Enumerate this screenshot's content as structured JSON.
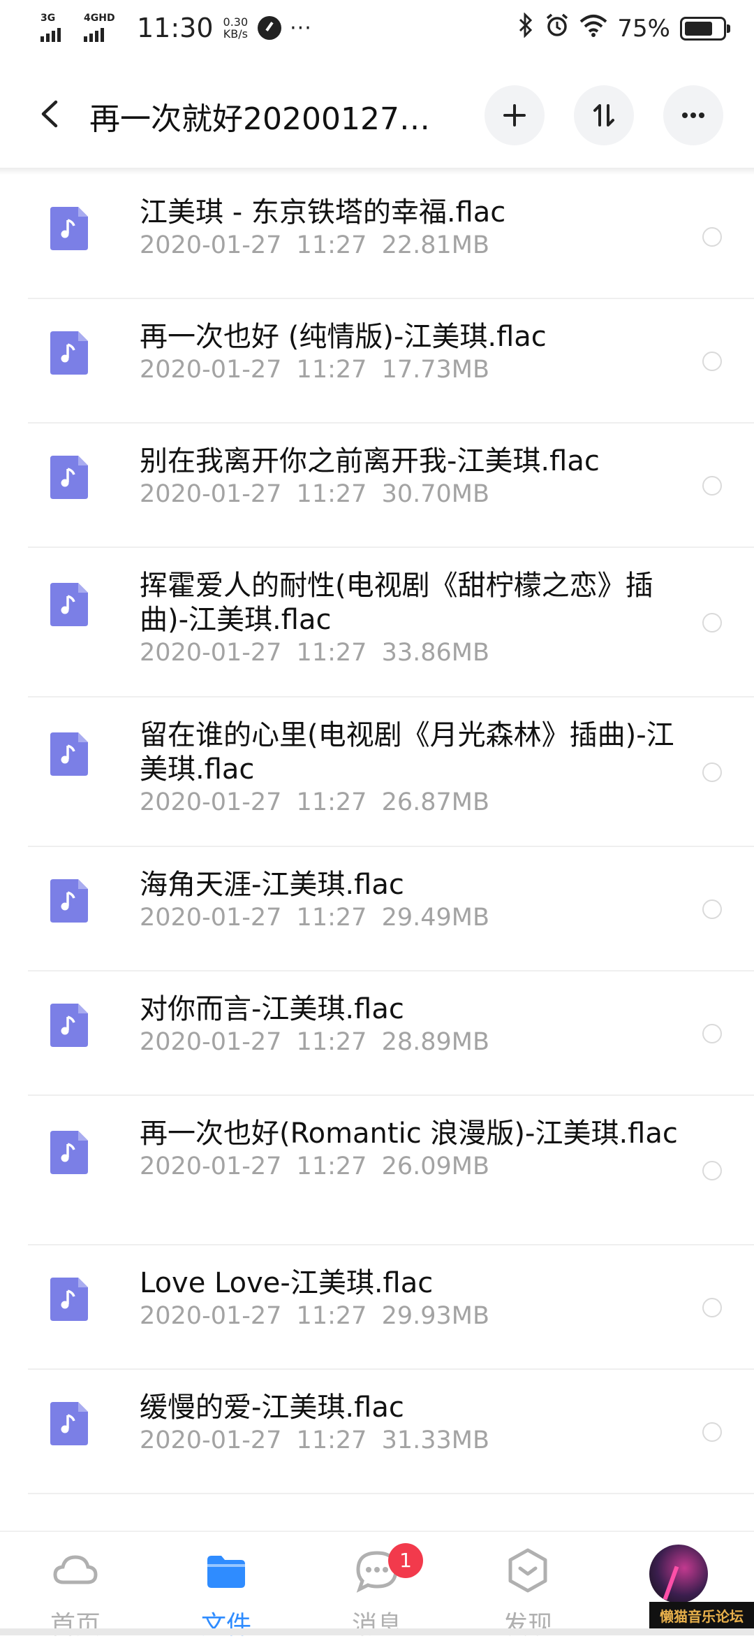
{
  "status_bar": {
    "network1": "3G",
    "network2": "4GHD",
    "time": "11:30",
    "speed_value": "0.30",
    "speed_unit": "KB/s",
    "more": "···",
    "battery_text": "75%",
    "battery_level": 0.75,
    "icons": [
      "bluetooth-icon",
      "alarm-icon",
      "wifi-icon",
      "battery-icon"
    ]
  },
  "header": {
    "title": "再一次就好20200127…",
    "actions": [
      "back-icon",
      "add-icon",
      "sort-icon",
      "more-icon"
    ]
  },
  "files": [
    {
      "name": "江美琪 - 东京铁塔的幸福.flac",
      "date": "2020-01-27",
      "time": "11:27",
      "size": "22.81MB"
    },
    {
      "name": "再一次也好 (纯情版)-江美琪.flac",
      "date": "2020-01-27",
      "time": "11:27",
      "size": "17.73MB"
    },
    {
      "name": "别在我离开你之前离开我-江美琪.flac",
      "date": "2020-01-27",
      "time": "11:27",
      "size": "30.70MB"
    },
    {
      "name": "挥霍爱人的耐性(电视剧《甜柠檬之恋》插曲)-江美琪.flac",
      "date": "2020-01-27",
      "time": "11:27",
      "size": "33.86MB"
    },
    {
      "name": "留在谁的心里(电视剧《月光森林》插曲)-江美琪.flac",
      "date": "2020-01-27",
      "time": "11:27",
      "size": "26.87MB"
    },
    {
      "name": "海角天涯-江美琪.flac",
      "date": "2020-01-27",
      "time": "11:27",
      "size": "29.49MB"
    },
    {
      "name": "对你而言-江美琪.flac",
      "date": "2020-01-27",
      "time": "11:27",
      "size": "28.89MB"
    },
    {
      "name": "再一次也好(Romantic 浪漫版)-江美琪.flac",
      "date": "2020-01-27",
      "time": "11:27",
      "size": "26.09MB"
    },
    {
      "name": "Love Love-江美琪.flac",
      "date": "2020-01-27",
      "time": "11:27",
      "size": "29.93MB"
    },
    {
      "name": "缓慢的爱-江美琪.flac",
      "date": "2020-01-27",
      "time": "11:27",
      "size": "31.33MB"
    }
  ],
  "bottom_nav": {
    "items": [
      {
        "label": "首页",
        "icon": "cloud-icon"
      },
      {
        "label": "文件",
        "icon": "folder-icon"
      },
      {
        "label": "消息",
        "icon": "chat-icon",
        "badge": "1"
      },
      {
        "label": "发现",
        "icon": "discover-icon"
      }
    ],
    "active_index": 1
  },
  "watermark": "懒猫音乐论坛",
  "colors": {
    "accent": "#2f8cff",
    "file_icon": "#7b7fe6",
    "badge": "#f23a4c",
    "meta_text": "#a3a3a3",
    "inactive_nav": "#b0b0b0"
  }
}
